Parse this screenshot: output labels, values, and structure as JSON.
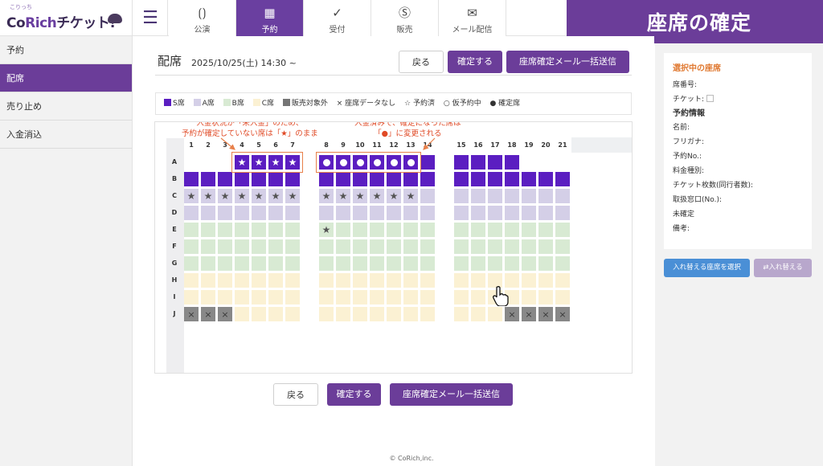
{
  "logo": {
    "small": "こりっち",
    "main_a": "Co",
    "main_b": "Rich",
    "main_c": "チケット!"
  },
  "tabs": [
    {
      "label": "公演",
      "icon": "curtain-icon",
      "glyph": "⟮⟯"
    },
    {
      "label": "予約",
      "icon": "calendar-icon",
      "glyph": "▦"
    },
    {
      "label": "受付",
      "icon": "check-icon",
      "glyph": "✓"
    },
    {
      "label": "販売",
      "icon": "dollar-icon",
      "glyph": "$"
    },
    {
      "label": "メール配信",
      "icon": "mail-icon",
      "glyph": "✉"
    }
  ],
  "header": {
    "title": "座席の確定"
  },
  "sidebar": {
    "items": [
      {
        "label": "予約"
      },
      {
        "label": "配席"
      },
      {
        "label": "売り止め"
      },
      {
        "label": "入金消込"
      }
    ]
  },
  "main": {
    "title": "配席",
    "date": "2025/10/25(土) 14:30 ~",
    "back": "戻る",
    "confirm": "確定する",
    "send_mail": "座席確定メール一括送信"
  },
  "legend": [
    {
      "label": "S席",
      "color": "#5b1ec1",
      "kind": "box"
    },
    {
      "label": "A席",
      "color": "#d4cfe7",
      "kind": "box"
    },
    {
      "label": "B席",
      "color": "#d8ead3",
      "kind": "box"
    },
    {
      "label": "C席",
      "color": "#fbf1d3",
      "kind": "box"
    },
    {
      "label": "販売対象外",
      "color": "#757575",
      "kind": "box"
    },
    {
      "label": "× 座席データなし",
      "kind": "text"
    },
    {
      "label": "☆ 予約済",
      "kind": "text"
    },
    {
      "label": "○ 仮予約中",
      "kind": "text"
    },
    {
      "label": "● 確定席",
      "kind": "text"
    }
  ],
  "annotations": {
    "left_1": "入金状況が「未入金」のため、",
    "left_2": "予約が確定していない席は「★」のまま",
    "right_1": "入金済みで、確定になった席は",
    "right_2": "「●」に変更される"
  },
  "seatmap": {
    "col_numbers": [
      "1",
      "2",
      "3",
      "4",
      "5",
      "6",
      "7",
      "8",
      "9",
      "10",
      "11",
      "12",
      "13",
      "14",
      "15",
      "16",
      "17",
      "18",
      "19",
      "20",
      "21"
    ],
    "row_labels": [
      "A",
      "B",
      "C",
      "D",
      "E",
      "F",
      "G",
      "H",
      "I",
      "J"
    ],
    "colors": {
      "S": "#5b1ec1",
      "A": "#d4cfe7",
      "B": "#d8ead3",
      "C": "#fbf1d3",
      "N": "#888888"
    },
    "rows": [
      {
        "label": "A",
        "seats": [
          null,
          null,
          null,
          {
            "c": "S",
            "m": "star"
          },
          {
            "c": "S",
            "m": "star"
          },
          {
            "c": "S",
            "m": "star"
          },
          {
            "c": "S",
            "m": "star"
          },
          {
            "c": "S",
            "m": "dot"
          },
          {
            "c": "S",
            "m": "dot"
          },
          {
            "c": "S",
            "m": "dot"
          },
          {
            "c": "S",
            "m": "dot"
          },
          {
            "c": "S",
            "m": "dot"
          },
          {
            "c": "S",
            "m": "dot"
          },
          {
            "c": "S"
          },
          {
            "c": "S"
          },
          {
            "c": "S"
          },
          {
            "c": "S"
          },
          {
            "c": "S"
          },
          null,
          null,
          null
        ]
      },
      {
        "label": "B",
        "seats": [
          "S",
          "S",
          "S",
          "S",
          "S",
          "S",
          "S",
          "S",
          "S",
          "S",
          "S",
          "S",
          "S",
          "S",
          "S",
          "S",
          "S",
          "S",
          "S",
          "S",
          "S"
        ]
      },
      {
        "label": "C",
        "seats": [
          {
            "c": "A",
            "m": "gstar"
          },
          {
            "c": "A",
            "m": "gstar"
          },
          {
            "c": "A",
            "m": "gstar"
          },
          {
            "c": "A",
            "m": "gstar"
          },
          {
            "c": "A",
            "m": "gstar"
          },
          {
            "c": "A",
            "m": "gstar"
          },
          {
            "c": "A",
            "m": "gstar"
          },
          {
            "c": "A",
            "m": "gstar"
          },
          {
            "c": "A",
            "m": "gstar"
          },
          {
            "c": "A",
            "m": "gstar"
          },
          {
            "c": "A",
            "m": "gstar"
          },
          {
            "c": "A",
            "m": "gstar"
          },
          {
            "c": "A",
            "m": "gstar"
          },
          "A",
          "A",
          "A",
          "A",
          "A",
          "A",
          "A",
          "A"
        ]
      },
      {
        "label": "D",
        "seats": [
          "A",
          "A",
          "A",
          "A",
          "A",
          "A",
          "A",
          "A",
          "A",
          "A",
          "A",
          "A",
          "A",
          "A",
          "A",
          "A",
          "A",
          "A",
          "A",
          "A",
          "A"
        ]
      },
      {
        "label": "E",
        "seats": [
          "B",
          "B",
          "B",
          "B",
          "B",
          "B",
          "B",
          {
            "c": "B",
            "m": "gstar"
          },
          "B",
          "B",
          "B",
          "B",
          "B",
          "B",
          "B",
          "B",
          "B",
          "B",
          "B",
          "B",
          "B"
        ]
      },
      {
        "label": "F",
        "seats": [
          "B",
          "B",
          "B",
          "B",
          "B",
          "B",
          "B",
          "B",
          "B",
          "B",
          "B",
          "B",
          "B",
          "B",
          "B",
          "B",
          "B",
          "B",
          "B",
          "B",
          "B"
        ]
      },
      {
        "label": "G",
        "seats": [
          "B",
          "B",
          "B",
          "B",
          "B",
          "B",
          "B",
          "B",
          "B",
          "B",
          "B",
          "B",
          "B",
          "B",
          "B",
          "B",
          "B",
          "B",
          "B",
          "B",
          "B"
        ]
      },
      {
        "label": "H",
        "seats": [
          "C",
          "C",
          "C",
          "C",
          "C",
          "C",
          "C",
          "C",
          "C",
          "C",
          "C",
          "C",
          "C",
          "C",
          "C",
          "C",
          "C",
          "C",
          "C",
          "C",
          "C"
        ]
      },
      {
        "label": "I",
        "seats": [
          "C",
          "C",
          "C",
          "C",
          "C",
          "C",
          "C",
          "C",
          "C",
          "C",
          "C",
          "C",
          "C",
          "C",
          "C",
          "C",
          "C",
          "C",
          "C",
          "C",
          "C"
        ]
      },
      {
        "label": "J",
        "seats": [
          {
            "c": "N",
            "m": "x"
          },
          {
            "c": "N",
            "m": "x"
          },
          {
            "c": "N",
            "m": "x"
          },
          "C",
          "C",
          "C",
          "C",
          "C",
          "C",
          "C",
          "C",
          "C",
          "C",
          "C",
          "C",
          "C",
          "C",
          {
            "c": "N",
            "m": "x"
          },
          {
            "c": "N",
            "m": "x"
          },
          {
            "c": "N",
            "m": "x"
          },
          {
            "c": "N",
            "m": "x"
          }
        ]
      }
    ]
  },
  "panel": {
    "selected_title": "選択中の座席",
    "seat_no": "席番号:",
    "ticket": "チケット:",
    "reservation_title": "予約情報",
    "name": "名前:",
    "furigana": "フリガナ:",
    "reservation_no": "予約No.:",
    "fee_type": "料金種別:",
    "ticket_count": "チケット枚数(同行者数):",
    "window": "取扱窓口(No.):",
    "status": "未確定",
    "remarks": "備考:",
    "btn_select": "入れ替える座席を選択",
    "btn_swap": "⇄入れ替える"
  },
  "footer": "© CoRich,inc."
}
